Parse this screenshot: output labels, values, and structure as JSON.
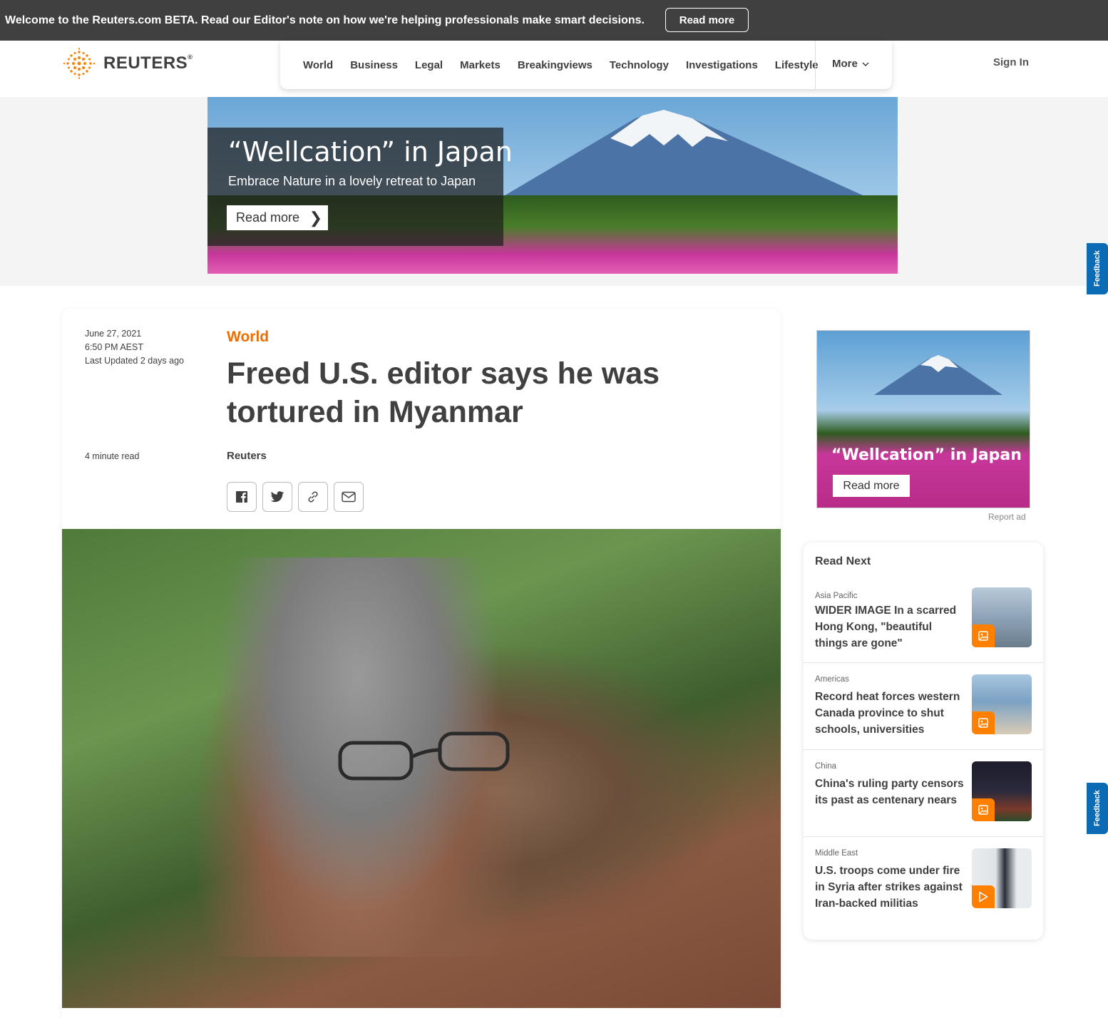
{
  "beta_bar": {
    "message": "Welcome to the Reuters.com BETA. Read our Editor's note on how we're helping professionals make smart decisions.",
    "button": "Read more"
  },
  "header": {
    "logo_text": "REUTERS",
    "logo_mark": "®",
    "nav": [
      "World",
      "Business",
      "Legal",
      "Markets",
      "Breakingviews",
      "Technology",
      "Investigations",
      "Lifestyle"
    ],
    "more": "More",
    "sign_in": "Sign In"
  },
  "hero_ad": {
    "title": "“Wellcation” in Japan",
    "subtitle": "Embrace Nature in a lovely retreat to Japan",
    "button": "Read more"
  },
  "feedback": "Feedback",
  "article": {
    "date": "June 27, 2021",
    "time": "6:50 PM AEST",
    "updated": "Last Updated 2 days ago",
    "read_time": "4 minute read",
    "section": "World",
    "headline": "Freed U.S. editor says he was tortured in Myanmar",
    "byline": "Reuters",
    "share_icons": [
      "facebook-icon",
      "twitter-icon",
      "link-icon",
      "email-icon"
    ]
  },
  "side_ad": {
    "title": "“Wellcation” in Japan",
    "button": "Read more",
    "report": "Report ad"
  },
  "read_next": {
    "title": "Read Next",
    "items": [
      {
        "category": "Asia Pacific",
        "headline": "WIDER IMAGE In a scarred Hong Kong, \"beautiful things are gone\"",
        "badge": "image-icon",
        "thumb_color": "#8fa3b8"
      },
      {
        "category": "Americas",
        "headline": "Record heat forces western Canada province to shut schools, universities",
        "badge": "image-icon",
        "thumb_color": "#7ba2c4"
      },
      {
        "category": "China",
        "headline": "China's ruling party censors its past as centenary nears",
        "badge": "image-icon",
        "thumb_color": "#2b2a3c"
      },
      {
        "category": "Middle East",
        "headline": "U.S. troops come under fire in Syria after strikes against Iran-backed militias",
        "badge": "play-icon",
        "thumb_color": "#e8ecef"
      }
    ]
  },
  "colors": {
    "accent": "#ef6c00",
    "feedback": "#0b6cb5",
    "beta_bar": "#404040"
  }
}
